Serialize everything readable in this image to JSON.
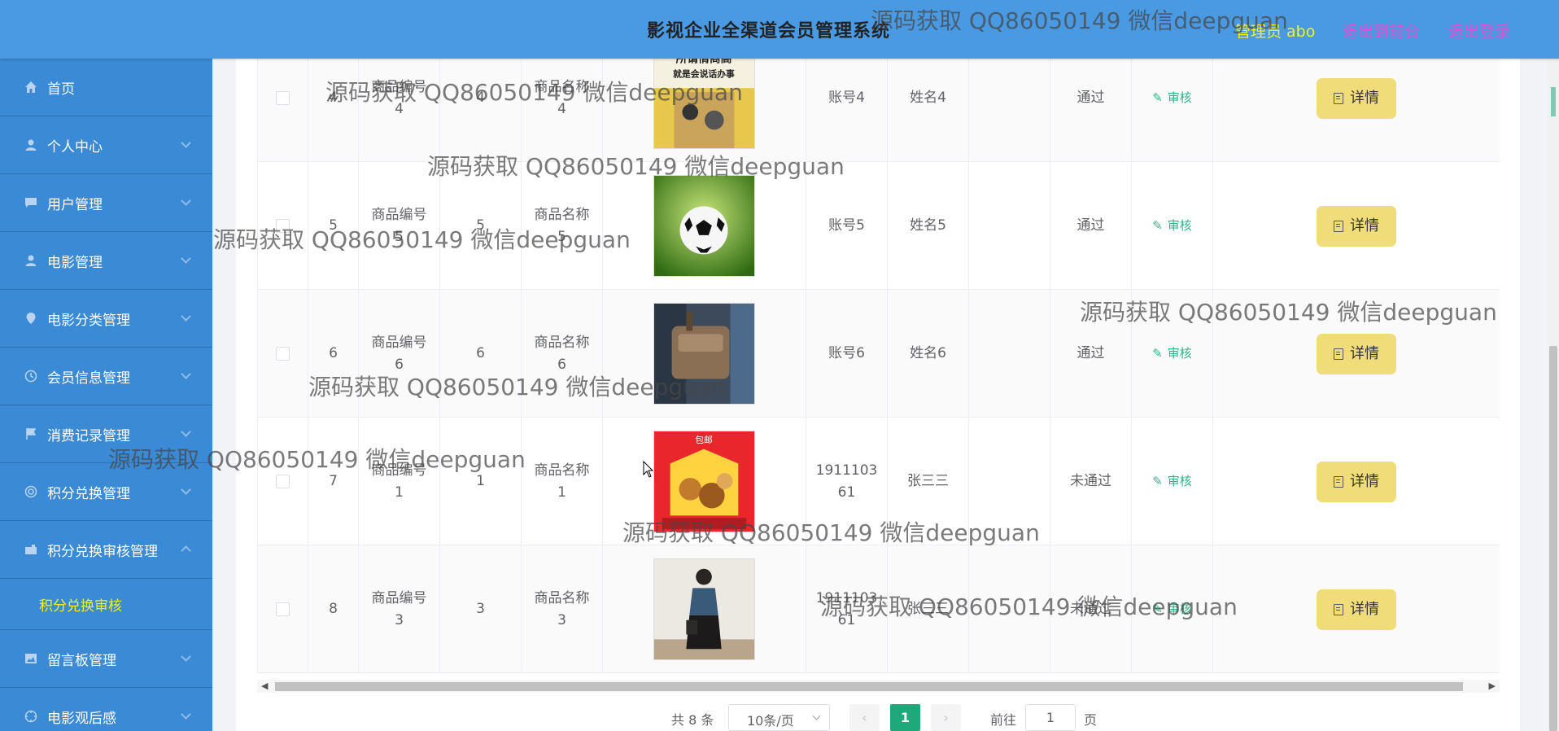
{
  "header": {
    "title": "影视企业全渠道会员管理系统",
    "admin_label": "管理员 abo",
    "to_front_label": "退出到前台",
    "logout_label": "退出登录",
    "colors": {
      "bg": "#4a9ae3",
      "admin": "#f2f226",
      "links": "#e24fd0"
    }
  },
  "sidebar": {
    "items": [
      {
        "label": "首页",
        "icon": "home-icon"
      },
      {
        "label": "个人中心",
        "icon": "user-icon"
      },
      {
        "label": "用户管理",
        "icon": "chat-icon"
      },
      {
        "label": "电影管理",
        "icon": "user-icon"
      },
      {
        "label": "电影分类管理",
        "icon": "location-icon"
      },
      {
        "label": "会员信息管理",
        "icon": "clock-icon"
      },
      {
        "label": "消费记录管理",
        "icon": "flag-icon"
      },
      {
        "label": "积分兑换管理",
        "icon": "circle-icon"
      },
      {
        "label": "积分兑换审核管理",
        "icon": "camera-icon"
      },
      {
        "label": "留言板管理",
        "icon": "picture-icon"
      },
      {
        "label": "电影观后感",
        "icon": "compass-icon"
      }
    ],
    "active_sub": "积分兑换审核"
  },
  "table": {
    "rows": [
      {
        "index": "4",
        "code": "商品编号\n4",
        "points": "4",
        "name": "商品名称\n4",
        "image": "book-cover",
        "account": "账号4",
        "realname": "姓名4",
        "status": "通过"
      },
      {
        "index": "5",
        "code": "商品编号\n5",
        "points": "5",
        "name": "商品名称\n5",
        "image": "soccer-ball",
        "account": "账号5",
        "realname": "姓名5",
        "status": "通过"
      },
      {
        "index": "6",
        "code": "商品编号\n6",
        "points": "6",
        "name": "商品名称\n6",
        "image": "waist-bag",
        "account": "账号6",
        "realname": "姓名6",
        "status": "通过"
      },
      {
        "index": "7",
        "code": "商品编号\n1",
        "points": "1",
        "name": "商品名称\n1",
        "image": "snack-box",
        "account": "1911103\n61",
        "realname": "张三三",
        "status": "未通过"
      },
      {
        "index": "8",
        "code": "商品编号\n3",
        "points": "3",
        "name": "商品名称\n3",
        "image": "fashion-photo",
        "account": "1911103\n61",
        "realname": "张三三",
        "status": "未通过"
      }
    ],
    "audit_label": "审核",
    "detail_label": "详情",
    "book_title_line1": "所谓情商高",
    "book_title_line2": "就是会说话办事",
    "snack_banner": "包邮"
  },
  "pagination": {
    "total": "共 8 条",
    "page_size": "10条/页",
    "current_page": "1",
    "goto_label": "前往",
    "goto_value": "1",
    "page_suffix": "页"
  },
  "watermark": "源码获取 QQ86050149 微信deepguan"
}
